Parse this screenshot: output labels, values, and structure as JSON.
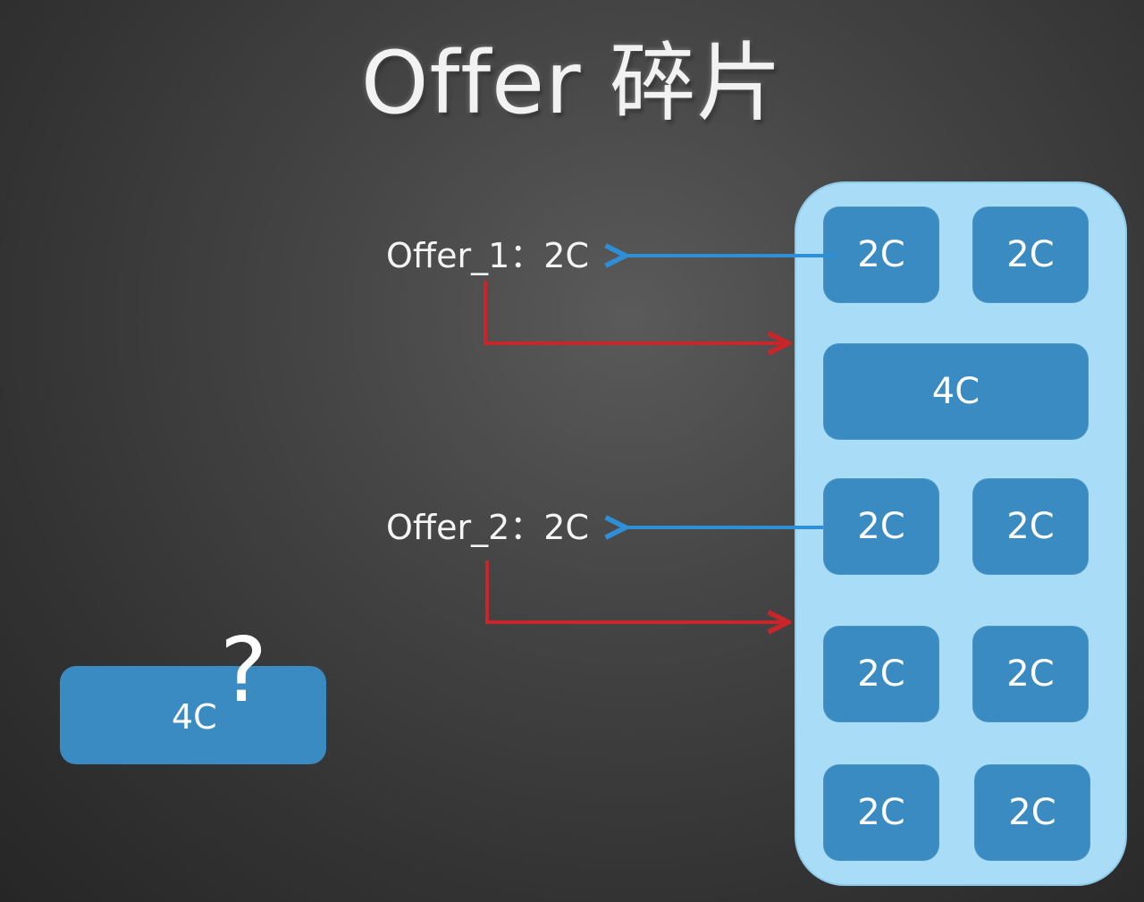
{
  "title": "Offer 碎片",
  "offers": [
    {
      "label": "Offer_1：2C"
    },
    {
      "label": "Offer_2：2C"
    }
  ],
  "node_slots": [
    "2C",
    "2C",
    "4C",
    "2C",
    "2C",
    "2C",
    "2C",
    "2C",
    "2C"
  ],
  "pending_task": {
    "label": "4C",
    "mark": "?"
  },
  "colors": {
    "background": "#3a3a3a",
    "container": "#a9dcf7",
    "slot": "#3a8bc1",
    "offer_arrow": "#2f8fd6",
    "assign_arrow": "#c8262a"
  }
}
